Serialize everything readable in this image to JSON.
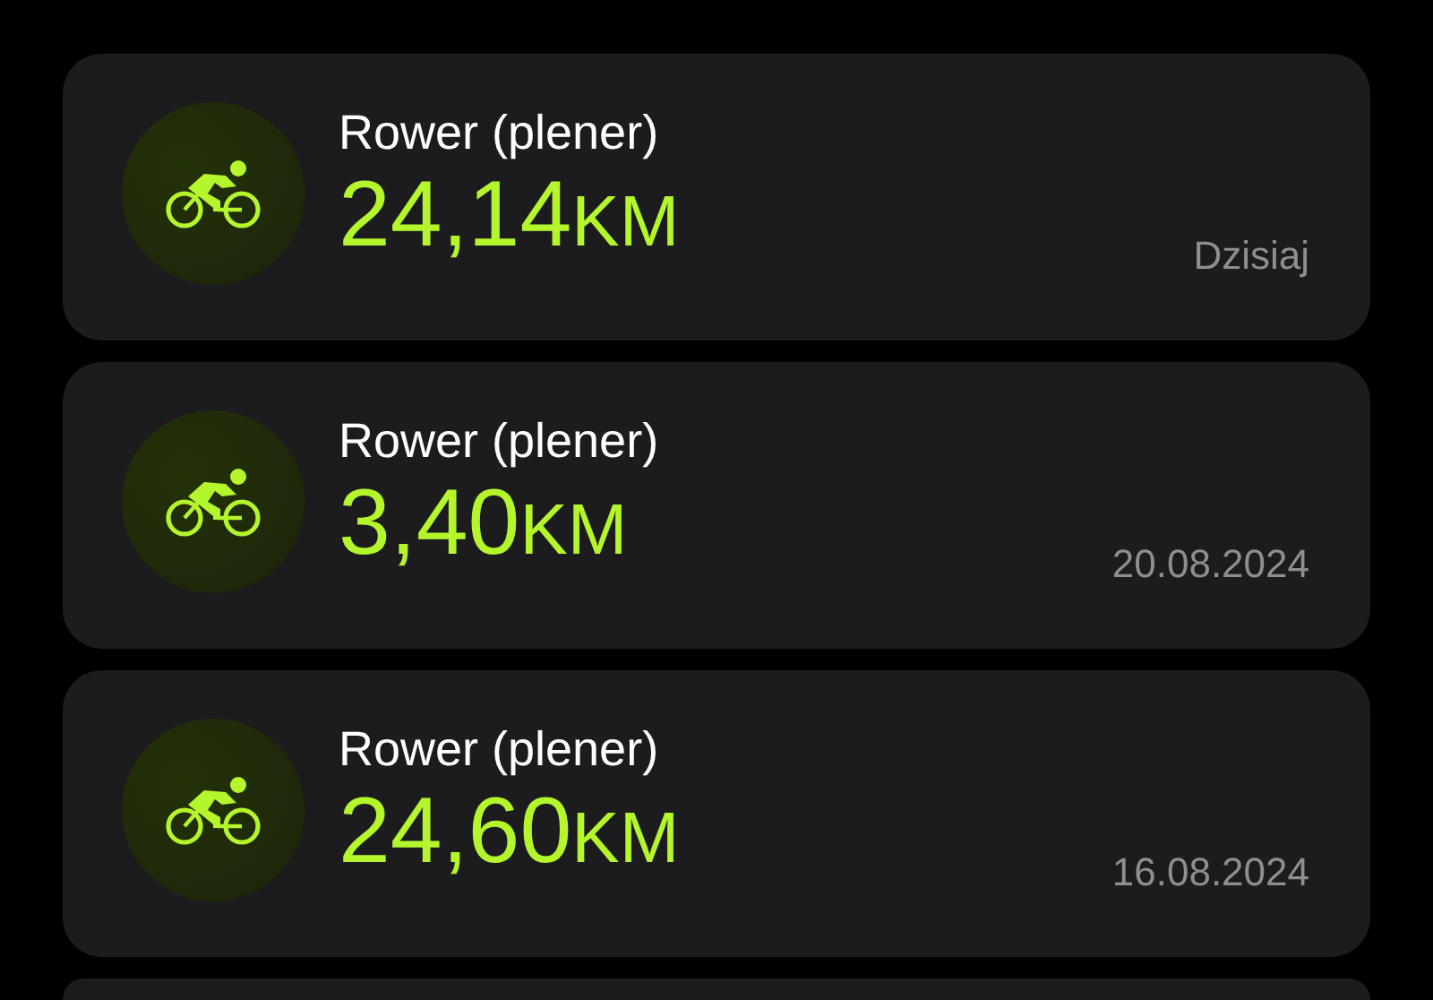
{
  "workouts": [
    {
      "title": "Rower (plener)",
      "distance": "24,14",
      "unit": "KM",
      "date": "Dzisiaj"
    },
    {
      "title": "Rower (plener)",
      "distance": "3,40",
      "unit": "KM",
      "date": "20.08.2024"
    },
    {
      "title": "Rower (plener)",
      "distance": "24,60",
      "unit": "KM",
      "date": "16.08.2024"
    }
  ]
}
